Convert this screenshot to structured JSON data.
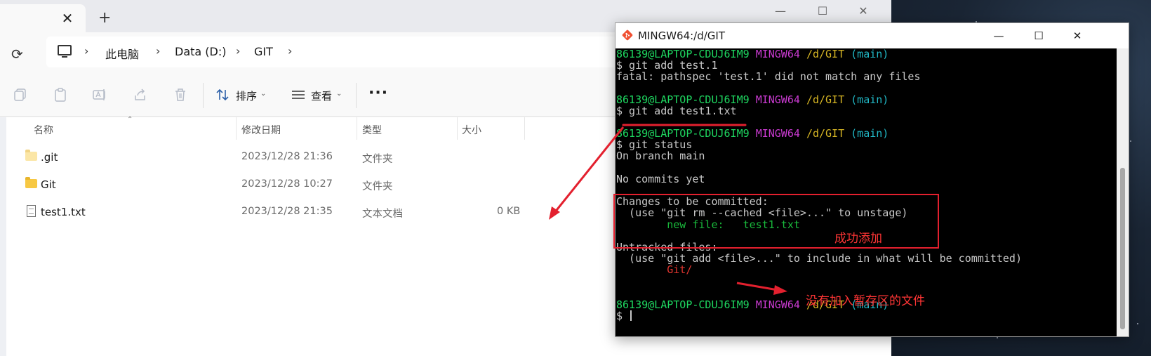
{
  "explorer": {
    "tab_close": "✕",
    "new_tab": "+",
    "window_controls": {
      "minimize": "—",
      "maximize": "☐",
      "close": "✕"
    },
    "refresh_icon": "⟳",
    "breadcrumbs": [
      "此电脑",
      "Data (D:)",
      "GIT"
    ],
    "breadcrumb_sep": "›",
    "toolbar": {
      "sort_label": "排序",
      "view_label": "查看",
      "more_label": "···",
      "caret": "⌄"
    },
    "columns": {
      "name": "名称",
      "modified": "修改日期",
      "type": "类型",
      "size": "大小",
      "sort_indicator": "⌃"
    },
    "files": [
      {
        "name": ".git",
        "modified": "2023/12/28 21:36",
        "type": "文件夹",
        "size": "",
        "icon": "folder-hidden-icon"
      },
      {
        "name": "Git",
        "modified": "2023/12/28 10:27",
        "type": "文件夹",
        "size": "",
        "icon": "folder-icon"
      },
      {
        "name": "test1.txt",
        "modified": "2023/12/28 21:35",
        "type": "文本文档",
        "size": "0 KB",
        "icon": "text-document-icon"
      }
    ]
  },
  "terminal": {
    "title": "MINGW64:/d/GIT",
    "window_controls": {
      "minimize": "—",
      "maximize": "☐",
      "close": "✕"
    },
    "prompt": {
      "user_host": "86139@LAPTOP-CDUJ6IM9",
      "env": "MINGW64",
      "path": "/d/GIT",
      "branch": "(main)"
    },
    "lines": {
      "cmd1": "$ git add test.1",
      "err1": "fatal: pathspec 'test.1' did not match any files",
      "cmd2": "$ git add test1.txt",
      "cmd3": "$ git status",
      "branch_line": "On branch main",
      "no_commits": "No commits yet",
      "changes_header": "Changes to be committed:",
      "changes_hint": "  (use \"git rm --cached <file>...\" to unstage)",
      "new_file": "        new file:   test1.txt",
      "untracked_header": "Untracked files:",
      "untracked_hint": "  (use \"git add <file>...\" to include in what will be committed)",
      "untracked_file": "        Git/",
      "final_prompt": "$ "
    }
  },
  "annotations": {
    "success_label": "成功添加",
    "not_staged_label": "没有加入暂存区的文件",
    "color": "#e3202e"
  }
}
